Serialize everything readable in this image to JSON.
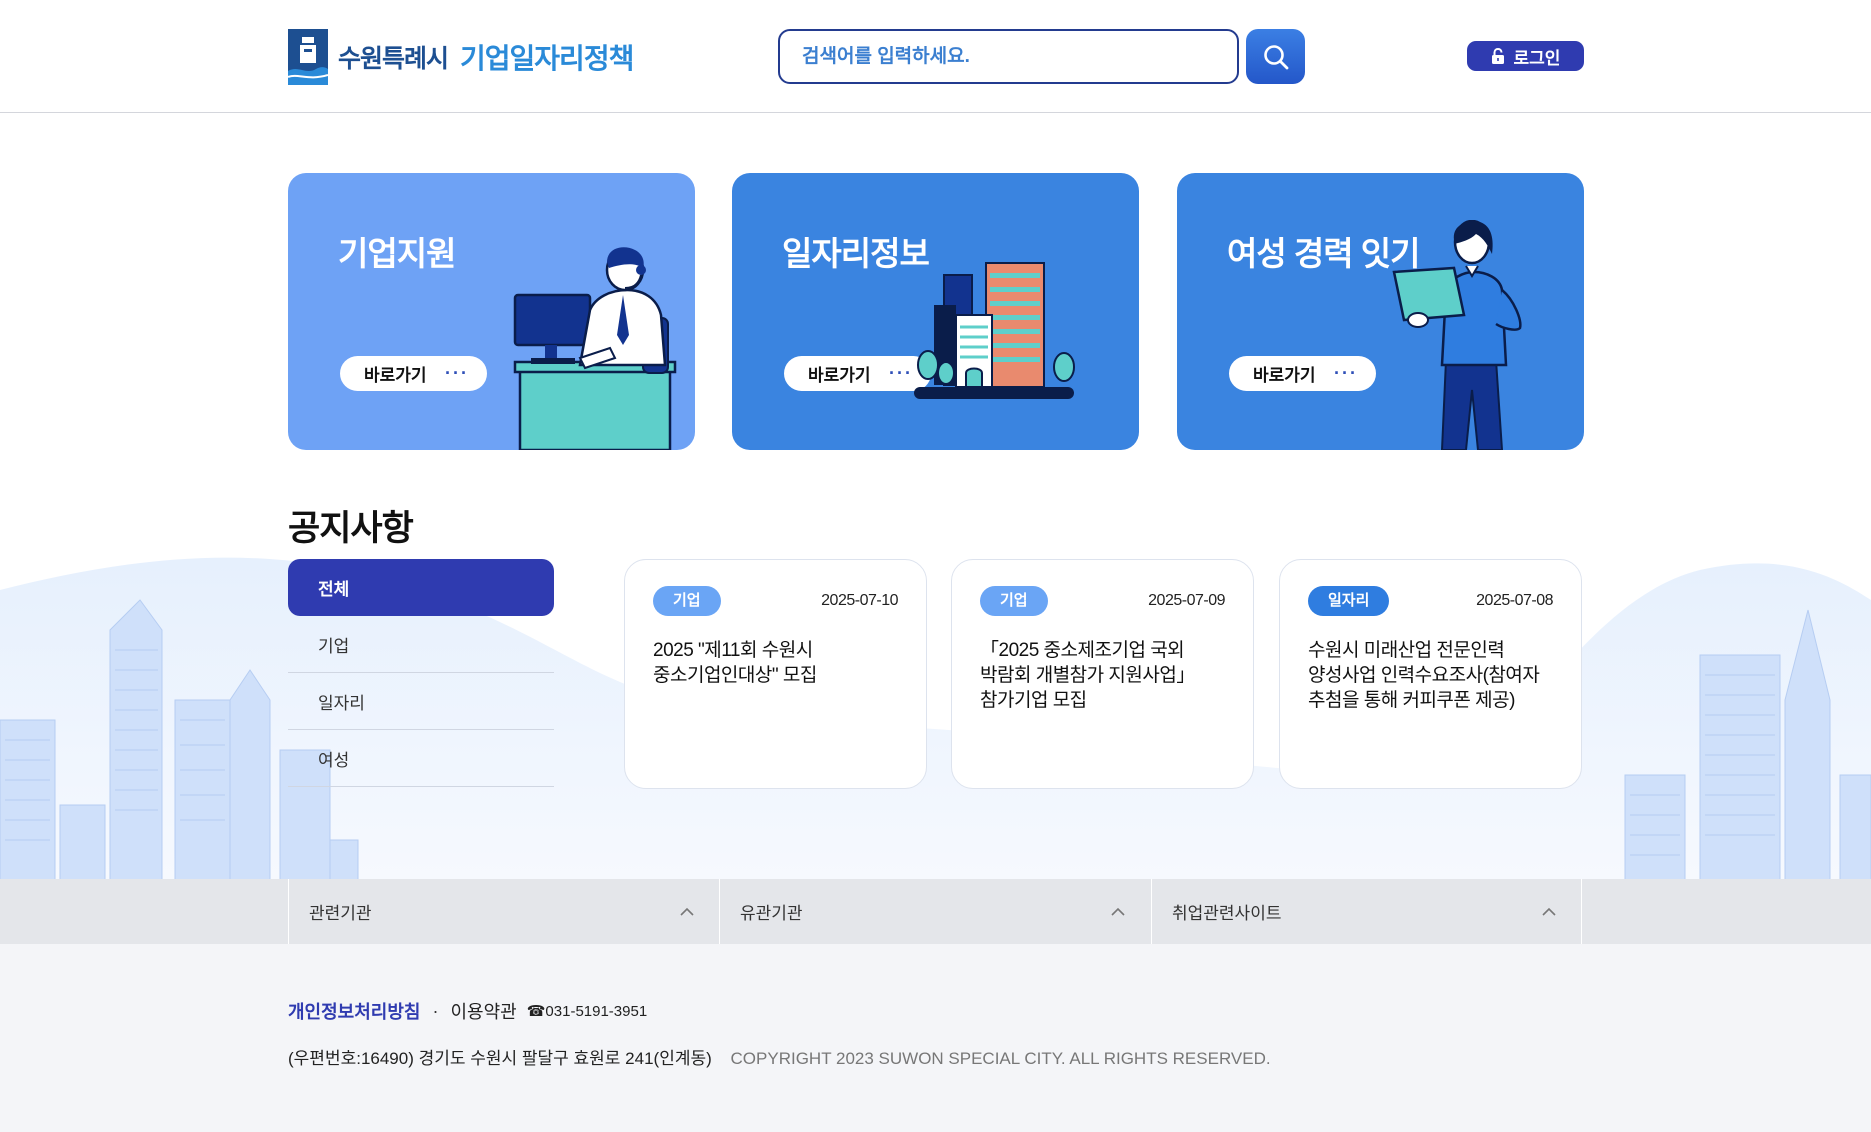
{
  "header": {
    "logo_city": "수원특례시",
    "logo_title": "기업일자리정책",
    "search_placeholder": "검색어를 입력하세요.",
    "login_label": "로그인"
  },
  "cards": [
    {
      "title": "기업지원",
      "button": "바로가기"
    },
    {
      "title": "일자리정보",
      "button": "바로가기"
    },
    {
      "title": "여성 경력 잇기",
      "button": "바로가기"
    }
  ],
  "notice": {
    "title": "공지사항",
    "filters": [
      "전체",
      "기업",
      "일자리",
      "여성"
    ],
    "active_filter": "전체",
    "items": [
      {
        "category": "기업",
        "date": "2025-07-10",
        "lines": [
          "2025 \"제11회 수원시",
          "중소기업인대상\" 모집"
        ]
      },
      {
        "category": "기업",
        "date": "2025-07-09",
        "lines": [
          "「2025 중소제조기업 국외",
          "박람회 개별참가 지원사업」",
          "참가기업 모집"
        ]
      },
      {
        "category": "일자리",
        "date": "2025-07-08",
        "lines": [
          "수원시 미래산업 전문인력",
          "양성사업 인력수요조사(참여자",
          "추첨을 통해 커피쿠폰 제공)"
        ]
      }
    ]
  },
  "footer_links": [
    "관련기관",
    "유관기관",
    "취업관련사이트"
  ],
  "footer": {
    "privacy": "개인정보처리방침",
    "separator": "·",
    "terms": "이용약관",
    "phone": "☎031-5191-3951",
    "address": "(우편번호:16490) 경기도 수원시 팔달구 효원로 241(인계동)",
    "copyright": "COPYRIGHT 2023 SUWON SPECIAL CITY. ALL RIGHTS RESERVED."
  },
  "colors": {
    "brand_navy": "#2f3bb0",
    "card_light": "#6ea2f5",
    "card_blue": "#3a84e0"
  }
}
